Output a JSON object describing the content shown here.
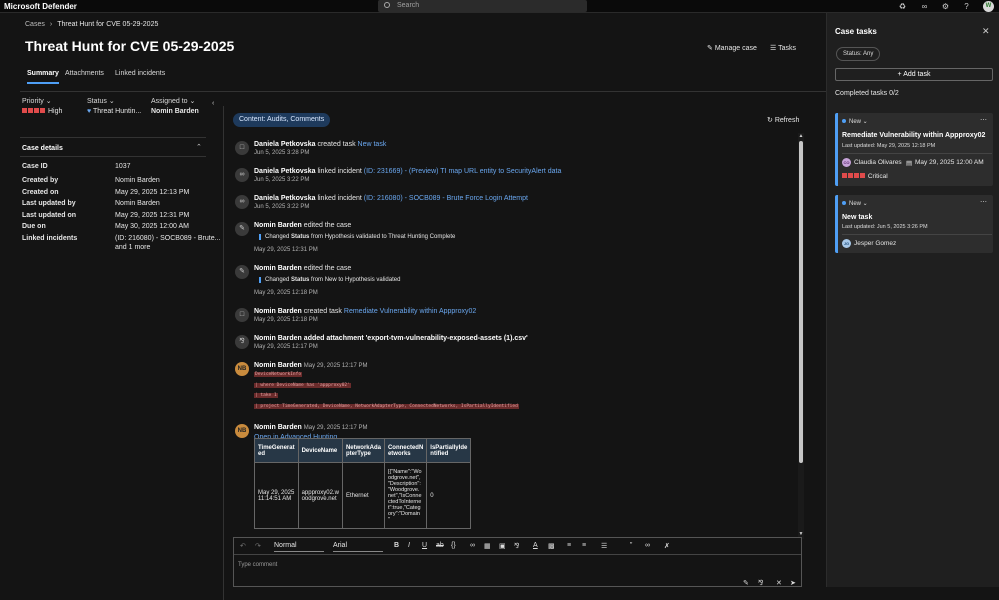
{
  "app": {
    "name": "Microsoft Defender",
    "search_placeholder": "Search",
    "user_initial": "W"
  },
  "breadcrumb": {
    "root": "Cases",
    "current": "Threat Hunt for CVE 05-29-2025"
  },
  "header": {
    "title": "Threat Hunt for CVE 05-29-2025",
    "manage_case": "Manage case",
    "tasks": "Tasks"
  },
  "tabs": [
    "Summary",
    "Attachments",
    "Linked incidents"
  ],
  "fields": {
    "priority_label": "Priority",
    "priority_value": "High",
    "status_label": "Status",
    "status_value": "Threat Huntin...",
    "assigned_label": "Assigned to",
    "assigned_value": "Nomin Barden"
  },
  "case_details": {
    "heading": "Case details",
    "rows": [
      {
        "key": "Case ID",
        "value": "1037"
      },
      {
        "key": "Created by",
        "value": "Nomin Barden"
      },
      {
        "key": "Created on",
        "value": "May 29, 2025 12:13 PM"
      },
      {
        "key": "Last updated by",
        "value": "Nomin Barden"
      },
      {
        "key": "Last updated on",
        "value": "May 29, 2025 12:31 PM"
      },
      {
        "key": "Due on",
        "value": "May 30, 2025 12:00 AM"
      },
      {
        "key": "Linked incidents",
        "value": "(ID: 216080) - SOCB089 - Brute...",
        "more": "and 1 more"
      }
    ]
  },
  "activity": {
    "filter": "Content: Audits, Comments",
    "refresh": "Refresh",
    "entries": [
      {
        "actor": "Daniela Petkovska",
        "action": "created task",
        "link": "New task",
        "time": "Jun 5, 2025 3:28 PM"
      },
      {
        "actor": "Daniela Petkovska",
        "action": "linked incident",
        "link": "(ID: 231669) - (Preview) TI map URL entity to SecurityAlert data",
        "time": "Jun 5, 2025 3:22 PM"
      },
      {
        "actor": "Daniela Petkovska",
        "action": "linked incident",
        "link": "(ID: 216080) - SOCB089 - Brute Force Login Attempt",
        "time": "Jun 5, 2025 3:22 PM"
      },
      {
        "actor": "Nomin Barden",
        "action": "edited the case",
        "change_pre": "Changed",
        "change_field": "Status",
        "change_detail": "from Hypothesis validated to Threat Hunting Complete",
        "time": "May 29, 2025 12:31 PM"
      },
      {
        "actor": "Nomin Barden",
        "action": "edited the case",
        "change_pre": "Changed",
        "change_field": "Status",
        "change_detail": "from New to Hypothesis validated",
        "time": "May 29, 2025 12:18 PM"
      },
      {
        "actor": "Nomin Barden",
        "action": "created task",
        "link": "Remediate Vulnerability within Appproxy02",
        "time": "May 29, 2025 12:18 PM"
      },
      {
        "actor": "Nomin Barden",
        "action": "added attachment 'export-tvm-vulnerability-exposed-assets (1).csv'",
        "time": "May 29, 2025 12:17 PM"
      }
    ],
    "comment1": {
      "initials": "NB",
      "author": "Nomin Barden",
      "time": "May 29, 2025 12:17 PM",
      "code": [
        "DeviceNetworkInfo",
        "| where DeviceName has 'appproxy02'",
        "| take 1",
        "| project TimeGenerated, DeviceName, NetworkAdapterType, ConnectedNetworks, IsPartiallyIdentified"
      ]
    },
    "comment2": {
      "initials": "NB",
      "author": "Nomin Barden",
      "time": "May 29, 2025 12:17 PM",
      "link": "Open in Advanced Hunting",
      "table": {
        "headers": [
          "TimeGenerat ed",
          "DeviceName",
          "NetworkAda pterType",
          "ConnectedN etworks",
          "IsPartiallyIde ntified"
        ],
        "row": [
          "May 29, 2025 11:14:51 AM",
          "appproxy02.w oodgrove.net",
          "Ethernet",
          "[{\"Name\":\"Wo odgrove.net\", \"Description\": \"Woodgrove. net\",\"IsConne ctedToInterne t\":true,\"Categ ory\":\"Domain \"",
          "0"
        ]
      }
    }
  },
  "editor": {
    "style": "Normal",
    "font": "Arial",
    "placeholder": "Type comment"
  },
  "panel": {
    "title": "Case tasks",
    "status_filter": "Status: Any",
    "add_task": "Add task",
    "completed": "Completed tasks 0/2",
    "tasks": [
      {
        "status": "New",
        "title": "Remediate Vulnerability within Appproxy02",
        "updated": "Last updated: May 29, 2025 12:18 PM",
        "assignee_initials": "CO",
        "assignee": "Claudia Olivares",
        "due": "May 29, 2025 12:00 AM",
        "severity": "Critical"
      },
      {
        "status": "New",
        "title": "New task",
        "updated": "Last updated: Jun 5, 2025 3:26 PM",
        "assignee_initials": "JG",
        "assignee": "Jesper Gomez"
      }
    ]
  },
  "colors": {
    "accent": "#4f9ff5",
    "severity": "#e04b4b",
    "link": "#6aa7ef",
    "background": "#141414"
  }
}
